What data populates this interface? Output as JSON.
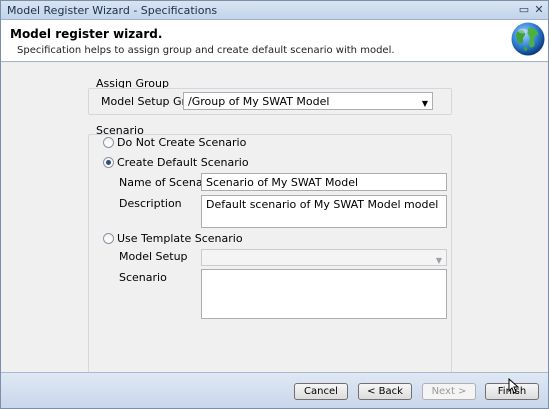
{
  "window": {
    "title": "Model Register Wizard - Specifications",
    "minimize_glyph": "▭",
    "close_glyph": "✕"
  },
  "header": {
    "title": "Model register wizard.",
    "subtitle": "Specification helps to assign group and create default scenario with model."
  },
  "assign_group": {
    "legend": "Assign Group",
    "model_setup_group_label": "Model Setup Group",
    "model_setup_group_value": "/Group of My SWAT Model"
  },
  "scenario": {
    "legend": "Scenario",
    "option_do_not_create": "Do Not Create Scenario",
    "option_create_default": "Create Default Scenario",
    "selected_option": "Create Default Scenario",
    "name_label": "Name of Scenario",
    "name_value": "Scenario of My SWAT Model",
    "description_label": "Description",
    "description_value": "Default scenario of My SWAT Model model",
    "option_use_template": "Use Template Scenario",
    "model_setup_label": "Model Setup",
    "model_setup_value": "",
    "scenario_label": "Scenario",
    "scenario_value": ""
  },
  "footer": {
    "cancel_label": "Cancel",
    "back_label": "< Back",
    "next_label": "Next >",
    "finish_label": "Finish"
  },
  "icons": {
    "header": "globe-icon",
    "dropdown": "chevron-down-icon"
  }
}
